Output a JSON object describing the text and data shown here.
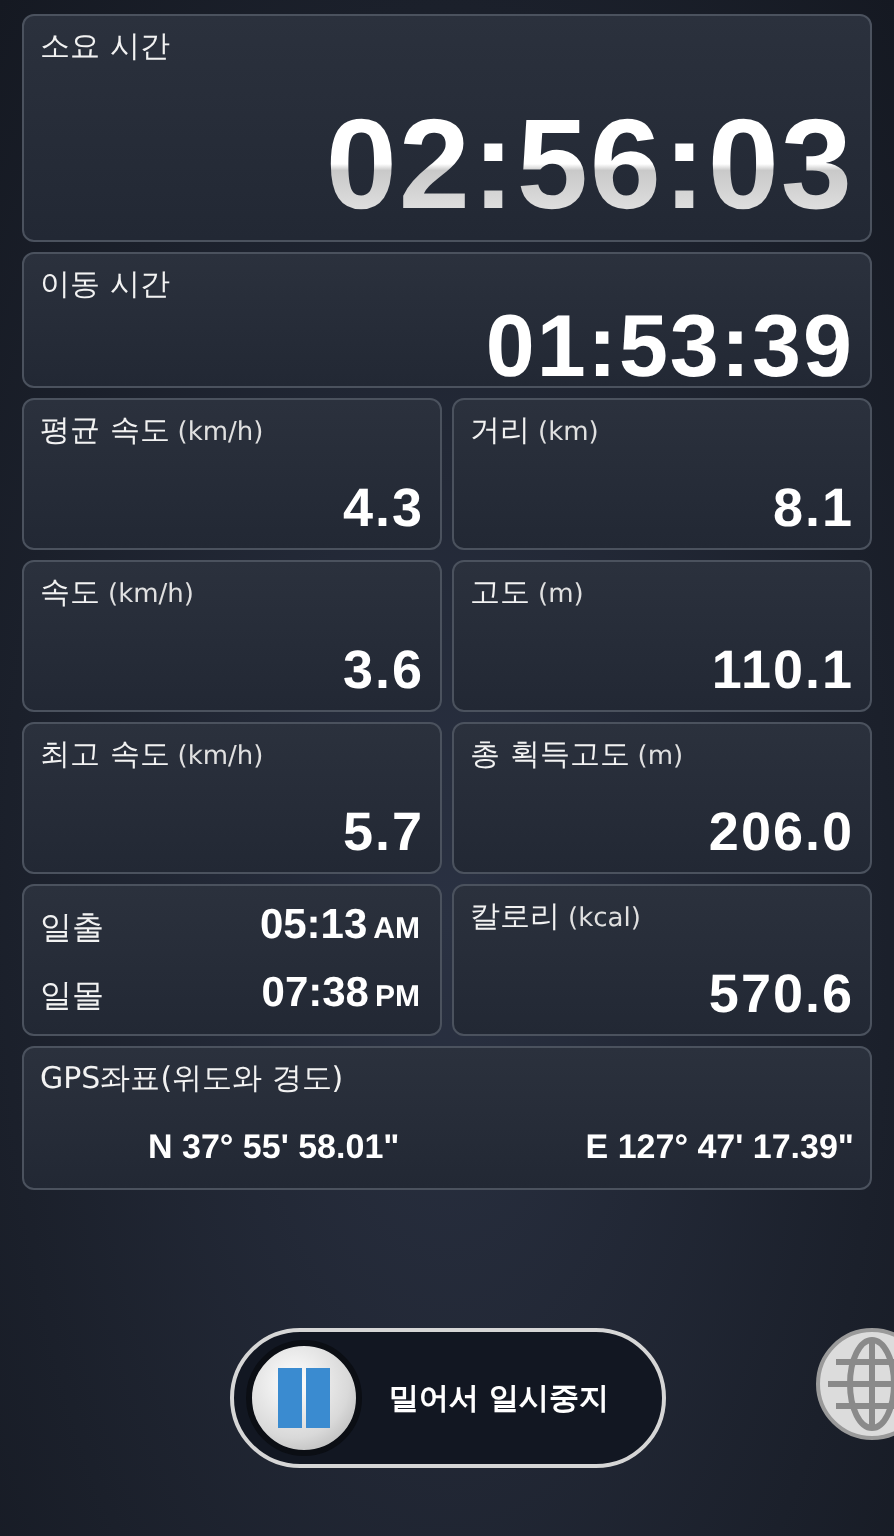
{
  "elapsed": {
    "label": "소요 시간",
    "value": "02:56:03"
  },
  "moving": {
    "label": "이동 시간",
    "value": "01:53:39"
  },
  "cells": [
    {
      "kind": "stat",
      "label": "평균 속도",
      "unit": "(km/h)",
      "value": "4.3"
    },
    {
      "kind": "stat",
      "label": "거리",
      "unit": "(km)",
      "value": "8.1"
    },
    {
      "kind": "stat",
      "label": "속도",
      "unit": "(km/h)",
      "value": "3.6"
    },
    {
      "kind": "stat",
      "label": "고도",
      "unit": "(m)",
      "value": "110.1"
    },
    {
      "kind": "stat",
      "label": "최고 속도",
      "unit": "(km/h)",
      "value": "5.7"
    },
    {
      "kind": "stat",
      "label": "총 획득고도",
      "unit": "(m)",
      "value": "206.0"
    },
    {
      "kind": "sun",
      "rows": [
        {
          "label": "일출",
          "time": "05:13",
          "suffix": "AM"
        },
        {
          "label": "일몰",
          "time": "07:38",
          "suffix": "PM"
        }
      ]
    },
    {
      "kind": "stat",
      "label": "칼로리",
      "unit": "(kcal)",
      "value": "570.6"
    }
  ],
  "gps": {
    "label": "GPS좌표(위도와 경도)",
    "latitude": "N 37° 55' 58.01\"",
    "longitude": "E 127° 47' 17.39\""
  },
  "slider": {
    "label": "밀어서 일시중지",
    "level": 0
  }
}
